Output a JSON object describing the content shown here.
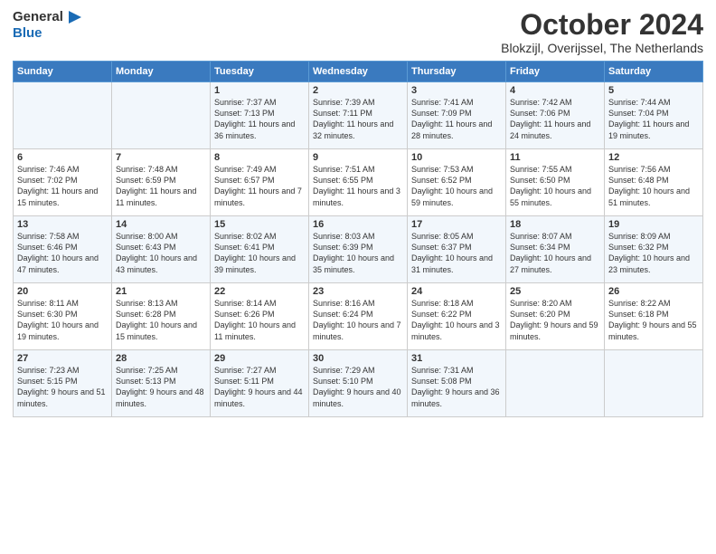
{
  "header": {
    "logo_line1": "General",
    "logo_line2": "Blue",
    "month_year": "October 2024",
    "location": "Blokzijl, Overijssel, The Netherlands"
  },
  "weekdays": [
    "Sunday",
    "Monday",
    "Tuesday",
    "Wednesday",
    "Thursday",
    "Friday",
    "Saturday"
  ],
  "weeks": [
    [
      {
        "day": "",
        "info": ""
      },
      {
        "day": "",
        "info": ""
      },
      {
        "day": "1",
        "info": "Sunrise: 7:37 AM\nSunset: 7:13 PM\nDaylight: 11 hours and 36 minutes."
      },
      {
        "day": "2",
        "info": "Sunrise: 7:39 AM\nSunset: 7:11 PM\nDaylight: 11 hours and 32 minutes."
      },
      {
        "day": "3",
        "info": "Sunrise: 7:41 AM\nSunset: 7:09 PM\nDaylight: 11 hours and 28 minutes."
      },
      {
        "day": "4",
        "info": "Sunrise: 7:42 AM\nSunset: 7:06 PM\nDaylight: 11 hours and 24 minutes."
      },
      {
        "day": "5",
        "info": "Sunrise: 7:44 AM\nSunset: 7:04 PM\nDaylight: 11 hours and 19 minutes."
      }
    ],
    [
      {
        "day": "6",
        "info": "Sunrise: 7:46 AM\nSunset: 7:02 PM\nDaylight: 11 hours and 15 minutes."
      },
      {
        "day": "7",
        "info": "Sunrise: 7:48 AM\nSunset: 6:59 PM\nDaylight: 11 hours and 11 minutes."
      },
      {
        "day": "8",
        "info": "Sunrise: 7:49 AM\nSunset: 6:57 PM\nDaylight: 11 hours and 7 minutes."
      },
      {
        "day": "9",
        "info": "Sunrise: 7:51 AM\nSunset: 6:55 PM\nDaylight: 11 hours and 3 minutes."
      },
      {
        "day": "10",
        "info": "Sunrise: 7:53 AM\nSunset: 6:52 PM\nDaylight: 10 hours and 59 minutes."
      },
      {
        "day": "11",
        "info": "Sunrise: 7:55 AM\nSunset: 6:50 PM\nDaylight: 10 hours and 55 minutes."
      },
      {
        "day": "12",
        "info": "Sunrise: 7:56 AM\nSunset: 6:48 PM\nDaylight: 10 hours and 51 minutes."
      }
    ],
    [
      {
        "day": "13",
        "info": "Sunrise: 7:58 AM\nSunset: 6:46 PM\nDaylight: 10 hours and 47 minutes."
      },
      {
        "day": "14",
        "info": "Sunrise: 8:00 AM\nSunset: 6:43 PM\nDaylight: 10 hours and 43 minutes."
      },
      {
        "day": "15",
        "info": "Sunrise: 8:02 AM\nSunset: 6:41 PM\nDaylight: 10 hours and 39 minutes."
      },
      {
        "day": "16",
        "info": "Sunrise: 8:03 AM\nSunset: 6:39 PM\nDaylight: 10 hours and 35 minutes."
      },
      {
        "day": "17",
        "info": "Sunrise: 8:05 AM\nSunset: 6:37 PM\nDaylight: 10 hours and 31 minutes."
      },
      {
        "day": "18",
        "info": "Sunrise: 8:07 AM\nSunset: 6:34 PM\nDaylight: 10 hours and 27 minutes."
      },
      {
        "day": "19",
        "info": "Sunrise: 8:09 AM\nSunset: 6:32 PM\nDaylight: 10 hours and 23 minutes."
      }
    ],
    [
      {
        "day": "20",
        "info": "Sunrise: 8:11 AM\nSunset: 6:30 PM\nDaylight: 10 hours and 19 minutes."
      },
      {
        "day": "21",
        "info": "Sunrise: 8:13 AM\nSunset: 6:28 PM\nDaylight: 10 hours and 15 minutes."
      },
      {
        "day": "22",
        "info": "Sunrise: 8:14 AM\nSunset: 6:26 PM\nDaylight: 10 hours and 11 minutes."
      },
      {
        "day": "23",
        "info": "Sunrise: 8:16 AM\nSunset: 6:24 PM\nDaylight: 10 hours and 7 minutes."
      },
      {
        "day": "24",
        "info": "Sunrise: 8:18 AM\nSunset: 6:22 PM\nDaylight: 10 hours and 3 minutes."
      },
      {
        "day": "25",
        "info": "Sunrise: 8:20 AM\nSunset: 6:20 PM\nDaylight: 9 hours and 59 minutes."
      },
      {
        "day": "26",
        "info": "Sunrise: 8:22 AM\nSunset: 6:18 PM\nDaylight: 9 hours and 55 minutes."
      }
    ],
    [
      {
        "day": "27",
        "info": "Sunrise: 7:23 AM\nSunset: 5:15 PM\nDaylight: 9 hours and 51 minutes."
      },
      {
        "day": "28",
        "info": "Sunrise: 7:25 AM\nSunset: 5:13 PM\nDaylight: 9 hours and 48 minutes."
      },
      {
        "day": "29",
        "info": "Sunrise: 7:27 AM\nSunset: 5:11 PM\nDaylight: 9 hours and 44 minutes."
      },
      {
        "day": "30",
        "info": "Sunrise: 7:29 AM\nSunset: 5:10 PM\nDaylight: 9 hours and 40 minutes."
      },
      {
        "day": "31",
        "info": "Sunrise: 7:31 AM\nSunset: 5:08 PM\nDaylight: 9 hours and 36 minutes."
      },
      {
        "day": "",
        "info": ""
      },
      {
        "day": "",
        "info": ""
      }
    ]
  ]
}
